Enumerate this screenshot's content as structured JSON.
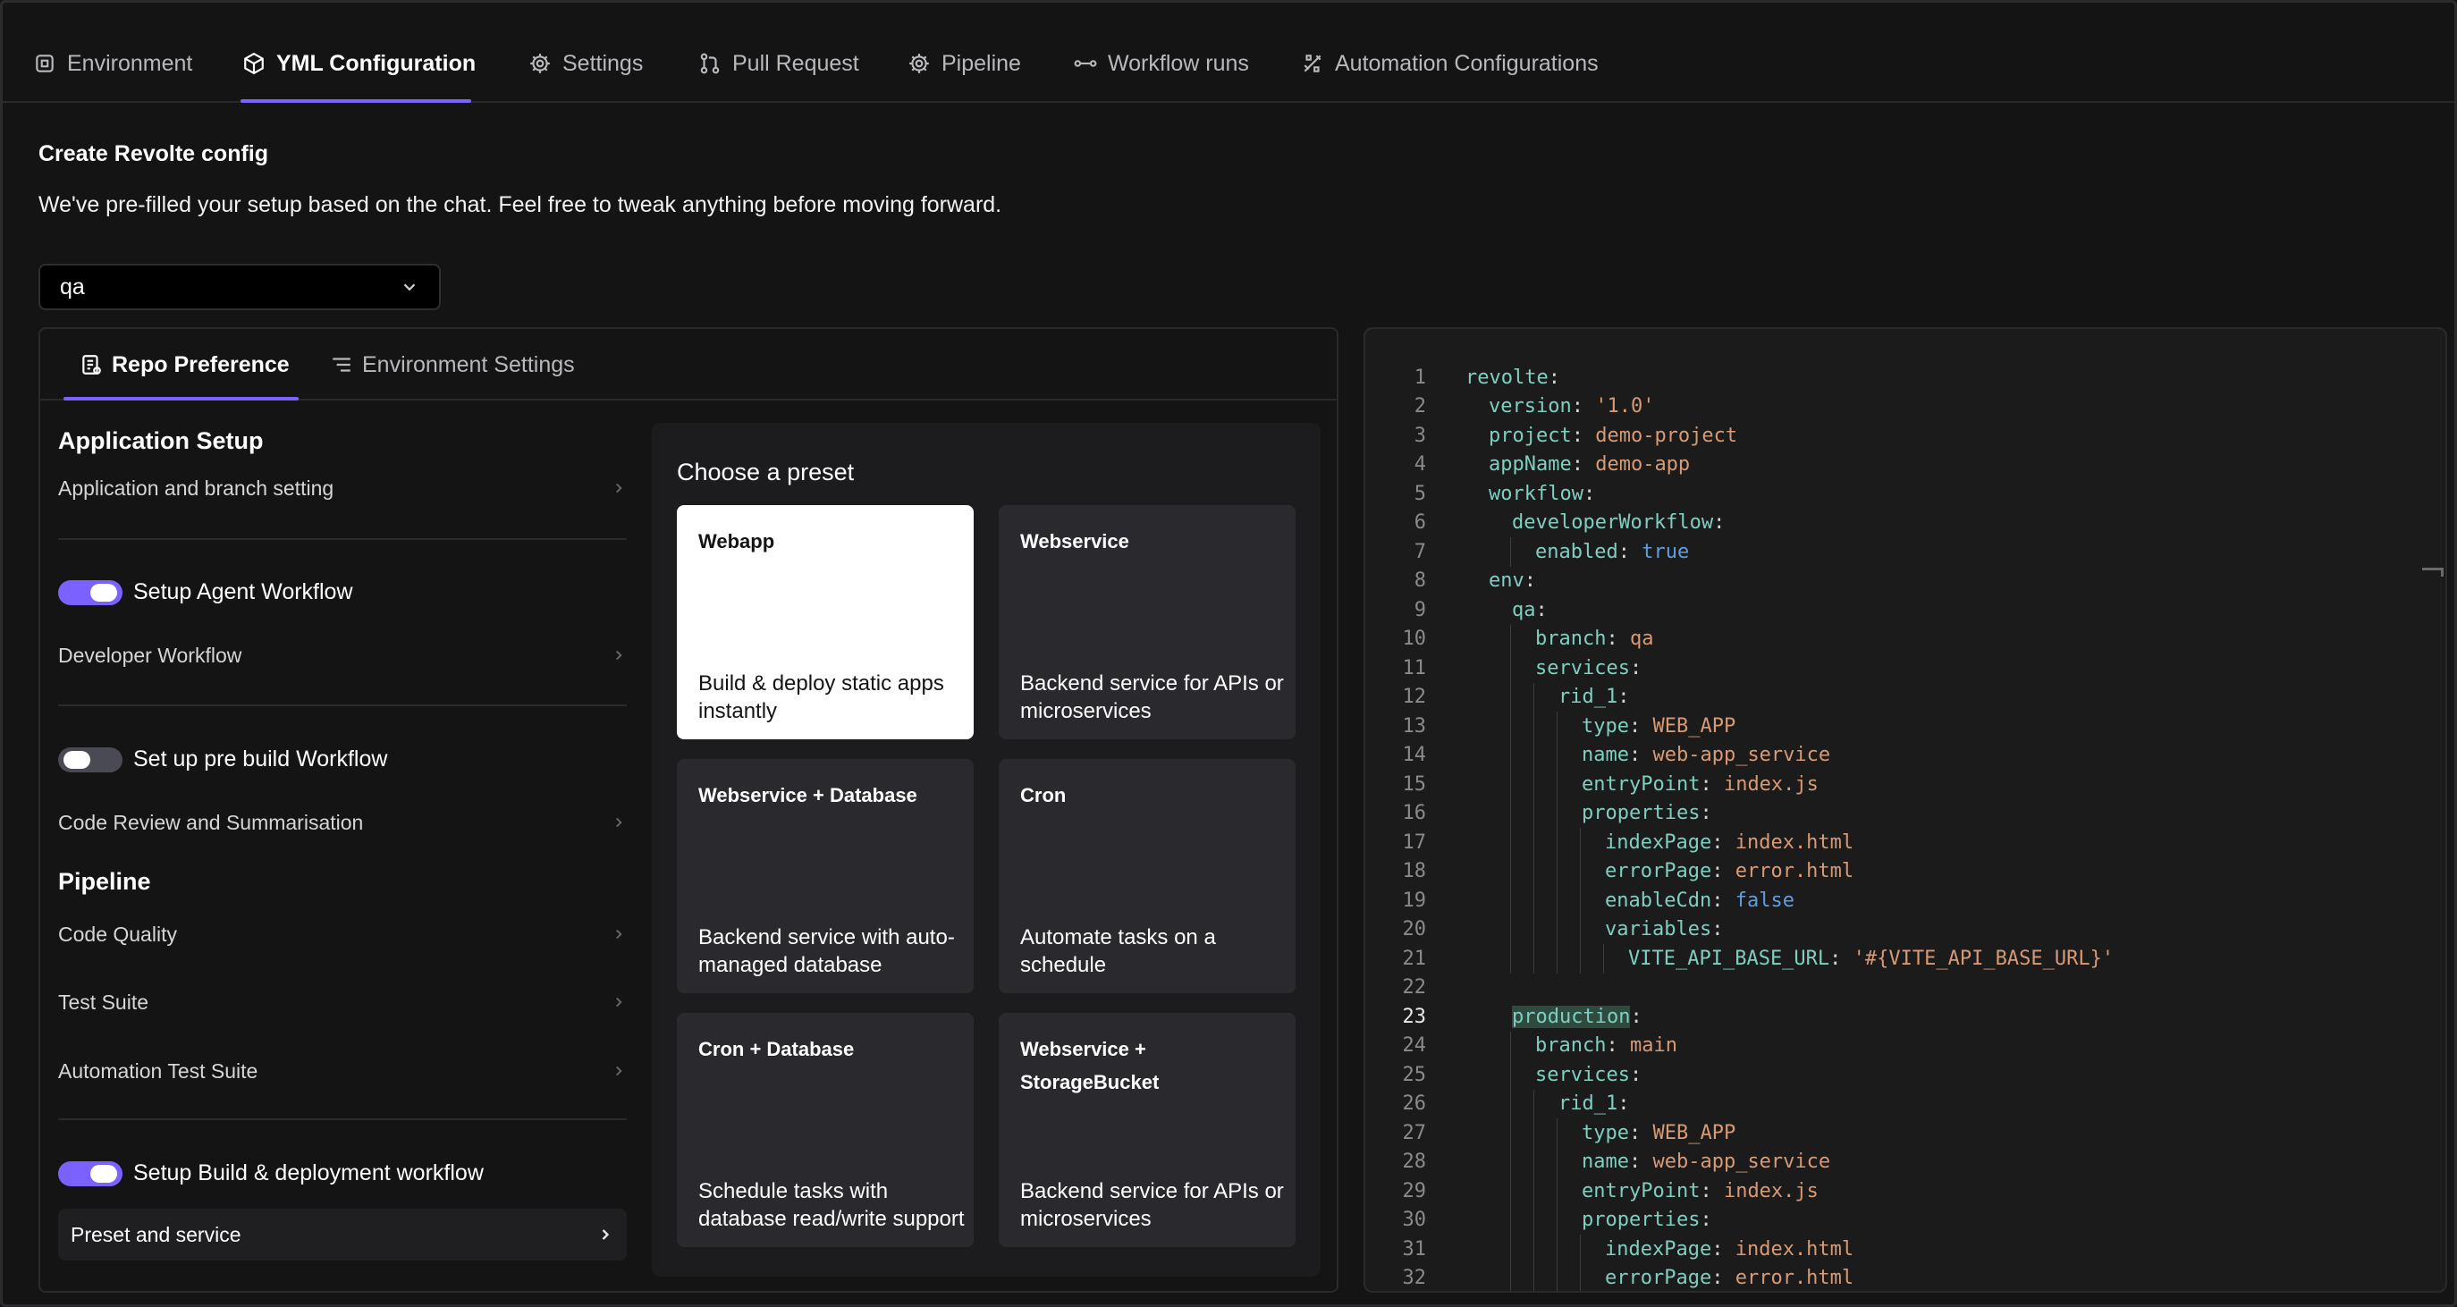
{
  "tabs": [
    {
      "label": "Environment",
      "icon": "environment-icon"
    },
    {
      "label": "YML Configuration",
      "icon": "cube-icon",
      "active": true
    },
    {
      "label": "Settings",
      "icon": "gear-icon"
    },
    {
      "label": "Pull Request",
      "icon": "pull-request-icon"
    },
    {
      "label": "Pipeline",
      "icon": "gear-icon"
    },
    {
      "label": "Workflow runs",
      "icon": "workflow-icon"
    },
    {
      "label": "Automation Configurations",
      "icon": "automation-icon"
    }
  ],
  "header": {
    "title": "Create Revolte config",
    "subtitle": "We've pre-filled your setup based on the chat. Feel free to tweak anything before moving forward."
  },
  "env_select": {
    "value": "qa"
  },
  "subtabs": [
    {
      "label": "Repo Preference",
      "icon": "repo-preference-icon",
      "active": true
    },
    {
      "label": "Environment Settings",
      "icon": "list-icon"
    }
  ],
  "settings": {
    "application_setup_heading": "Application Setup",
    "application_branch_setting": "Application and branch setting",
    "setup_agent_workflow": {
      "label": "Setup Agent Workflow",
      "enabled": true
    },
    "developer_workflow": "Developer Workflow",
    "pre_build_workflow": {
      "label": "Set up pre build Workflow",
      "enabled": false
    },
    "code_review": "Code Review and Summarisation",
    "pipeline_heading": "Pipeline",
    "code_quality": "Code Quality",
    "test_suite": "Test Suite",
    "automation_test_suite": "Automation Test Suite",
    "build_deploy_workflow": {
      "label": "Setup Build & deployment workflow",
      "enabled": true
    },
    "preset_and_service": "Preset and service"
  },
  "presets": {
    "title": "Choose a preset",
    "items": [
      {
        "name": "Webapp",
        "description": "Build & deploy static apps instantly",
        "selected": true
      },
      {
        "name": "Webservice",
        "description": "Backend service for APIs or microservices"
      },
      {
        "name": "Webservice + Database",
        "description": "Backend service with auto-managed database"
      },
      {
        "name": "Cron",
        "description": "Automate tasks on a schedule"
      },
      {
        "name": "Cron + Database",
        "description": "Schedule tasks with database read/write support"
      },
      {
        "name": "Webservice + StorageBucket",
        "description": "Backend service for APIs or microservices"
      }
    ]
  },
  "editor": {
    "current_line": 23,
    "lines": [
      {
        "n": "1",
        "indent": 0,
        "key": "revolte"
      },
      {
        "n": "2",
        "indent": 1,
        "key": "version",
        "val": "'1.0'",
        "t": "s"
      },
      {
        "n": "3",
        "indent": 1,
        "key": "project",
        "val": "demo-project",
        "t": "s"
      },
      {
        "n": "4",
        "indent": 1,
        "key": "appName",
        "val": "demo-app",
        "t": "s"
      },
      {
        "n": "5",
        "indent": 1,
        "key": "workflow"
      },
      {
        "n": "6",
        "indent": 2,
        "key": "developerWorkflow"
      },
      {
        "n": "7",
        "indent": 3,
        "key": "enabled",
        "val": "true",
        "t": "b"
      },
      {
        "n": "8",
        "indent": 1,
        "key": "env"
      },
      {
        "n": "9",
        "indent": 2,
        "key": "qa"
      },
      {
        "n": "10",
        "indent": 3,
        "key": "branch",
        "val": "qa",
        "t": "s"
      },
      {
        "n": "11",
        "indent": 3,
        "key": "services"
      },
      {
        "n": "12",
        "indent": 4,
        "key": "rid_1"
      },
      {
        "n": "13",
        "indent": 5,
        "key": "type",
        "val": "WEB_APP",
        "t": "s"
      },
      {
        "n": "14",
        "indent": 5,
        "key": "name",
        "val": "web-app_service",
        "t": "s"
      },
      {
        "n": "15",
        "indent": 5,
        "key": "entryPoint",
        "val": "index.js",
        "t": "s"
      },
      {
        "n": "16",
        "indent": 5,
        "key": "properties"
      },
      {
        "n": "17",
        "indent": 6,
        "key": "indexPage",
        "val": "index.html",
        "t": "s"
      },
      {
        "n": "18",
        "indent": 6,
        "key": "errorPage",
        "val": "error.html",
        "t": "s"
      },
      {
        "n": "19",
        "indent": 6,
        "key": "enableCdn",
        "val": "false",
        "t": "b"
      },
      {
        "n": "20",
        "indent": 6,
        "key": "variables"
      },
      {
        "n": "21",
        "indent": 7,
        "key": "VITE_API_BASE_URL",
        "val": "'#{VITE_API_BASE_URL}'",
        "t": "s"
      },
      {
        "n": "22",
        "indent": 0,
        "key": ""
      },
      {
        "n": "23",
        "indent": 2,
        "key": "production",
        "hl": true
      },
      {
        "n": "24",
        "indent": 3,
        "key": "branch",
        "val": "main",
        "t": "s"
      },
      {
        "n": "25",
        "indent": 3,
        "key": "services"
      },
      {
        "n": "26",
        "indent": 4,
        "key": "rid_1"
      },
      {
        "n": "27",
        "indent": 5,
        "key": "type",
        "val": "WEB_APP",
        "t": "s"
      },
      {
        "n": "28",
        "indent": 5,
        "key": "name",
        "val": "web-app_service",
        "t": "s"
      },
      {
        "n": "29",
        "indent": 5,
        "key": "entryPoint",
        "val": "index.js",
        "t": "s"
      },
      {
        "n": "30",
        "indent": 5,
        "key": "properties"
      },
      {
        "n": "31",
        "indent": 6,
        "key": "indexPage",
        "val": "index.html",
        "t": "s"
      },
      {
        "n": "32",
        "indent": 6,
        "key": "errorPage",
        "val": "error.html",
        "t": "s"
      }
    ]
  }
}
